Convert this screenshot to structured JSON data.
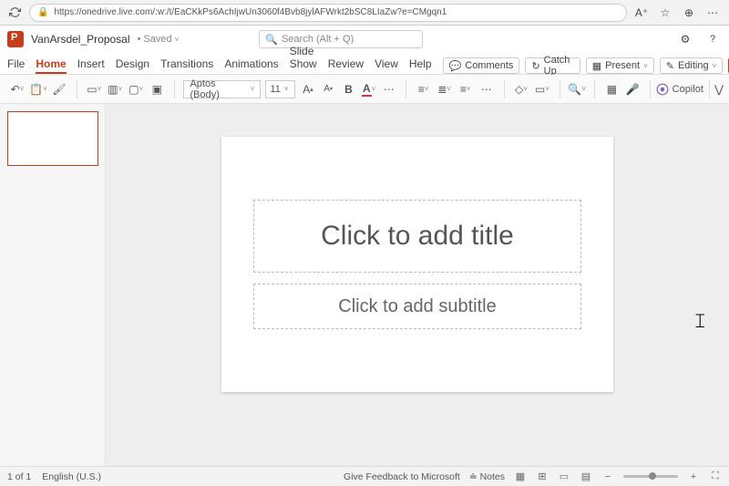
{
  "browser": {
    "url": "https://onedrive.live.com/:w:/t/EaCKkPs6AchIjwUn3060f4Bvb8jylAFWrkt2bSC8LIaZw?e=CMgqn1"
  },
  "doc": {
    "title": "VanArsdel_Proposal",
    "saved": "Saved"
  },
  "search": {
    "placeholder": "Search (Alt + Q)"
  },
  "tabs": {
    "file": "File",
    "home": "Home",
    "insert": "Insert",
    "design": "Design",
    "transitions": "Transitions",
    "animations": "Animations",
    "slideshow": "Slide Show",
    "review": "Review",
    "view": "View",
    "help": "Help"
  },
  "actions": {
    "comments": "Comments",
    "catchup": "Catch Up",
    "present": "Present",
    "editing": "Editing"
  },
  "ribbon": {
    "font": "Aptos (Body)",
    "size": "11",
    "copilot": "Copilot"
  },
  "slide": {
    "title_placeholder": "Click to add title",
    "subtitle_placeholder": "Click to add subtitle"
  },
  "status": {
    "slide_count": "1 of 1",
    "language": "English (U.S.)",
    "feedback": "Give Feedback to Microsoft",
    "notes": "Notes"
  }
}
